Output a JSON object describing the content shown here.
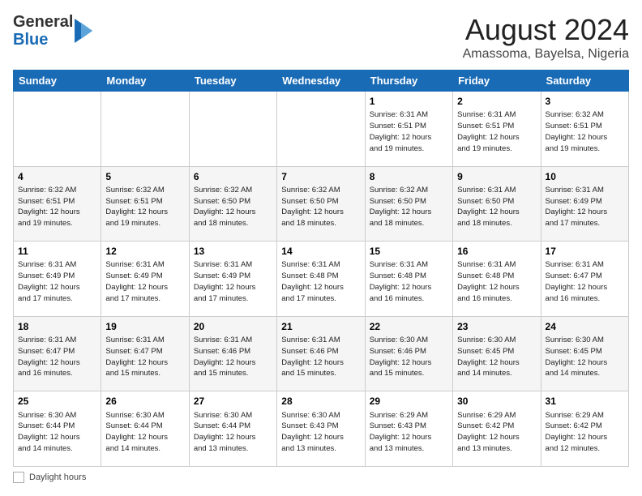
{
  "header": {
    "logo_line1": "General",
    "logo_line2": "Blue",
    "month_title": "August 2024",
    "location": "Amassoma, Bayelsa, Nigeria"
  },
  "days_of_week": [
    "Sunday",
    "Monday",
    "Tuesday",
    "Wednesday",
    "Thursday",
    "Friday",
    "Saturday"
  ],
  "footer": {
    "daylight_label": "Daylight hours"
  },
  "weeks": [
    [
      {
        "day": "",
        "info": ""
      },
      {
        "day": "",
        "info": ""
      },
      {
        "day": "",
        "info": ""
      },
      {
        "day": "",
        "info": ""
      },
      {
        "day": "1",
        "info": "Sunrise: 6:31 AM\nSunset: 6:51 PM\nDaylight: 12 hours\nand 19 minutes."
      },
      {
        "day": "2",
        "info": "Sunrise: 6:31 AM\nSunset: 6:51 PM\nDaylight: 12 hours\nand 19 minutes."
      },
      {
        "day": "3",
        "info": "Sunrise: 6:32 AM\nSunset: 6:51 PM\nDaylight: 12 hours\nand 19 minutes."
      }
    ],
    [
      {
        "day": "4",
        "info": "Sunrise: 6:32 AM\nSunset: 6:51 PM\nDaylight: 12 hours\nand 19 minutes."
      },
      {
        "day": "5",
        "info": "Sunrise: 6:32 AM\nSunset: 6:51 PM\nDaylight: 12 hours\nand 19 minutes."
      },
      {
        "day": "6",
        "info": "Sunrise: 6:32 AM\nSunset: 6:50 PM\nDaylight: 12 hours\nand 18 minutes."
      },
      {
        "day": "7",
        "info": "Sunrise: 6:32 AM\nSunset: 6:50 PM\nDaylight: 12 hours\nand 18 minutes."
      },
      {
        "day": "8",
        "info": "Sunrise: 6:32 AM\nSunset: 6:50 PM\nDaylight: 12 hours\nand 18 minutes."
      },
      {
        "day": "9",
        "info": "Sunrise: 6:31 AM\nSunset: 6:50 PM\nDaylight: 12 hours\nand 18 minutes."
      },
      {
        "day": "10",
        "info": "Sunrise: 6:31 AM\nSunset: 6:49 PM\nDaylight: 12 hours\nand 17 minutes."
      }
    ],
    [
      {
        "day": "11",
        "info": "Sunrise: 6:31 AM\nSunset: 6:49 PM\nDaylight: 12 hours\nand 17 minutes."
      },
      {
        "day": "12",
        "info": "Sunrise: 6:31 AM\nSunset: 6:49 PM\nDaylight: 12 hours\nand 17 minutes."
      },
      {
        "day": "13",
        "info": "Sunrise: 6:31 AM\nSunset: 6:49 PM\nDaylight: 12 hours\nand 17 minutes."
      },
      {
        "day": "14",
        "info": "Sunrise: 6:31 AM\nSunset: 6:48 PM\nDaylight: 12 hours\nand 17 minutes."
      },
      {
        "day": "15",
        "info": "Sunrise: 6:31 AM\nSunset: 6:48 PM\nDaylight: 12 hours\nand 16 minutes."
      },
      {
        "day": "16",
        "info": "Sunrise: 6:31 AM\nSunset: 6:48 PM\nDaylight: 12 hours\nand 16 minutes."
      },
      {
        "day": "17",
        "info": "Sunrise: 6:31 AM\nSunset: 6:47 PM\nDaylight: 12 hours\nand 16 minutes."
      }
    ],
    [
      {
        "day": "18",
        "info": "Sunrise: 6:31 AM\nSunset: 6:47 PM\nDaylight: 12 hours\nand 16 minutes."
      },
      {
        "day": "19",
        "info": "Sunrise: 6:31 AM\nSunset: 6:47 PM\nDaylight: 12 hours\nand 15 minutes."
      },
      {
        "day": "20",
        "info": "Sunrise: 6:31 AM\nSunset: 6:46 PM\nDaylight: 12 hours\nand 15 minutes."
      },
      {
        "day": "21",
        "info": "Sunrise: 6:31 AM\nSunset: 6:46 PM\nDaylight: 12 hours\nand 15 minutes."
      },
      {
        "day": "22",
        "info": "Sunrise: 6:30 AM\nSunset: 6:46 PM\nDaylight: 12 hours\nand 15 minutes."
      },
      {
        "day": "23",
        "info": "Sunrise: 6:30 AM\nSunset: 6:45 PM\nDaylight: 12 hours\nand 14 minutes."
      },
      {
        "day": "24",
        "info": "Sunrise: 6:30 AM\nSunset: 6:45 PM\nDaylight: 12 hours\nand 14 minutes."
      }
    ],
    [
      {
        "day": "25",
        "info": "Sunrise: 6:30 AM\nSunset: 6:44 PM\nDaylight: 12 hours\nand 14 minutes."
      },
      {
        "day": "26",
        "info": "Sunrise: 6:30 AM\nSunset: 6:44 PM\nDaylight: 12 hours\nand 14 minutes."
      },
      {
        "day": "27",
        "info": "Sunrise: 6:30 AM\nSunset: 6:44 PM\nDaylight: 12 hours\nand 13 minutes."
      },
      {
        "day": "28",
        "info": "Sunrise: 6:30 AM\nSunset: 6:43 PM\nDaylight: 12 hours\nand 13 minutes."
      },
      {
        "day": "29",
        "info": "Sunrise: 6:29 AM\nSunset: 6:43 PM\nDaylight: 12 hours\nand 13 minutes."
      },
      {
        "day": "30",
        "info": "Sunrise: 6:29 AM\nSunset: 6:42 PM\nDaylight: 12 hours\nand 13 minutes."
      },
      {
        "day": "31",
        "info": "Sunrise: 6:29 AM\nSunset: 6:42 PM\nDaylight: 12 hours\nand 12 minutes."
      }
    ]
  ]
}
